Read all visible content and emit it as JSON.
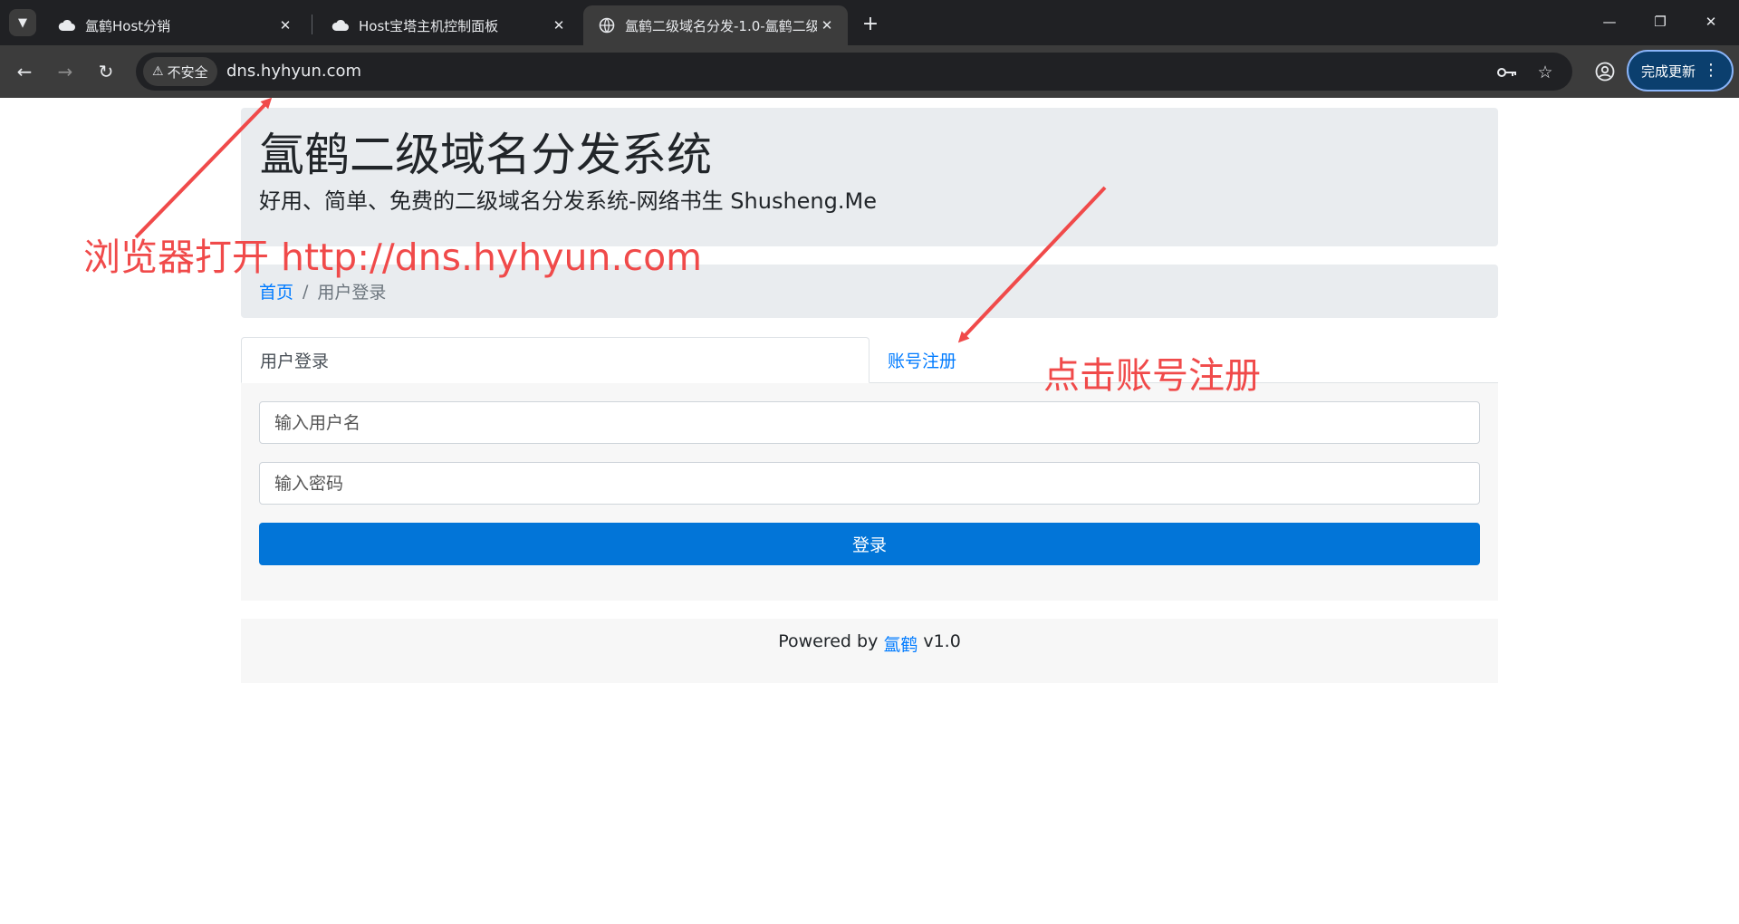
{
  "browser": {
    "tabs": [
      {
        "title": "氲鹤Host分销",
        "icon": "cloud-icon",
        "active": false
      },
      {
        "title": "Host宝塔主机控制面板",
        "icon": "cloud-icon",
        "active": false
      },
      {
        "title": "氲鹤二级域名分发-1.0-氲鹤二级",
        "icon": "globe-icon",
        "active": true
      }
    ],
    "security_label": "不安全",
    "url": "dns.hyhyun.com",
    "update_button": "完成更新"
  },
  "page": {
    "title": "氲鹤二级域名分发系统",
    "subtitle": "好用、简单、免费的二级域名分发系统-网络书生 Shusheng.Me",
    "breadcrumb": {
      "home": "首页",
      "separator": "/",
      "current": "用户登录"
    },
    "tabs": [
      {
        "label": "用户登录",
        "active": true
      },
      {
        "label": "账号注册",
        "active": false
      }
    ],
    "form": {
      "username_placeholder": "输入用户名",
      "password_placeholder": "输入密码",
      "submit_label": "登录"
    },
    "footer": {
      "prefix": "Powered by",
      "brand": "氲鹤",
      "version": "v1.0"
    }
  },
  "annotations": {
    "open_browser": "浏览器打开 http://dns.hyhyun.com",
    "click_register": "点击账号注册",
    "color": "#f04a4a"
  }
}
